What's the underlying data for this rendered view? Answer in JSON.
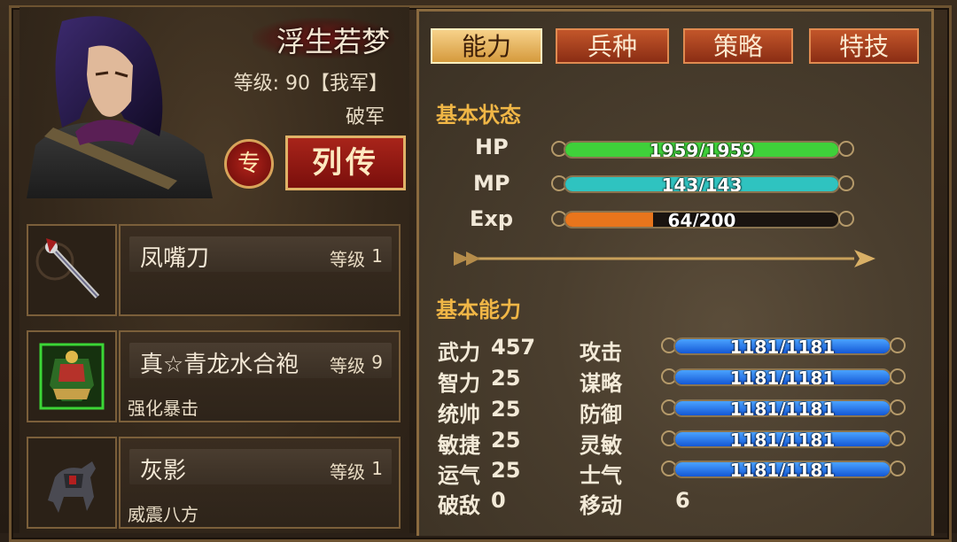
{
  "hero": {
    "name": "浮生若梦",
    "level_text": "等级: 90【我军】",
    "faction": "破军",
    "zhuan_label": "专",
    "liezhuan_label": "列传"
  },
  "equipment": [
    {
      "name": "凤嘴刀",
      "level_label": "等级",
      "level": "1",
      "effect": "",
      "icon": "spear-icon"
    },
    {
      "name": "真☆青龙水合袍",
      "level_label": "等级",
      "level": "9",
      "effect": "强化暴击",
      "icon": "armor-icon"
    },
    {
      "name": "灰影",
      "level_label": "等级",
      "level": "1",
      "effect": "威震八方",
      "icon": "horse-icon"
    }
  ],
  "tabs": [
    {
      "label": "能力",
      "active": true
    },
    {
      "label": "兵种",
      "active": false
    },
    {
      "label": "策略",
      "active": false
    },
    {
      "label": "特技",
      "active": false
    }
  ],
  "basic_status": {
    "title": "基本状态",
    "hp": {
      "label": "HP",
      "text": "1959/1959",
      "fill": 1.0,
      "color": "#3fd13a"
    },
    "mp": {
      "label": "MP",
      "text": "143/143",
      "fill": 1.0,
      "color": "#2fc3c0"
    },
    "exp": {
      "label": "Exp",
      "text": "64/200",
      "fill": 0.32,
      "color": "#e8751c"
    }
  },
  "basic_ability": {
    "title": "基本能力",
    "left": [
      {
        "label": "武力",
        "value": "457"
      },
      {
        "label": "智力",
        "value": "25"
      },
      {
        "label": "统帅",
        "value": "25"
      },
      {
        "label": "敏捷",
        "value": "25"
      },
      {
        "label": "运气",
        "value": "25"
      },
      {
        "label": "破敌",
        "value": "0"
      }
    ],
    "right": [
      {
        "label": "攻击",
        "text": "1181/1181"
      },
      {
        "label": "谋略",
        "text": "1181/1181"
      },
      {
        "label": "防御",
        "text": "1181/1181"
      },
      {
        "label": "灵敏",
        "text": "1181/1181"
      },
      {
        "label": "士气",
        "text": "1181/1181"
      }
    ],
    "move_label": "移动",
    "move_value": "6"
  }
}
